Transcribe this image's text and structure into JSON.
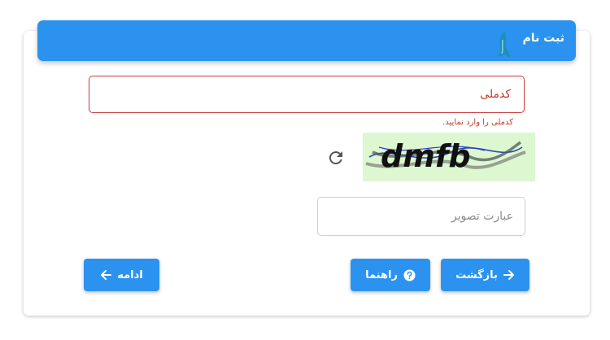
{
  "header": {
    "title": "ثبت نام",
    "logo_icon": "logo-icon",
    "color": "#2b93ef"
  },
  "form": {
    "national_code": {
      "value": "",
      "placeholder": "کدملی",
      "error": "کدملی را وارد نمایید."
    },
    "captcha": {
      "image_text": "dmfb",
      "refresh_icon": "refresh-icon",
      "input_value": "",
      "input_placeholder": "عبارت تصویر"
    }
  },
  "buttons": {
    "back": {
      "label": "بازگشت",
      "icon": "arrow-right-icon"
    },
    "help": {
      "label": "راهنما",
      "icon": "question-circle-icon"
    },
    "continue": {
      "label": "ادامه",
      "icon": "arrow-left-icon"
    }
  },
  "colors": {
    "primary": "#2b93ef",
    "error": "#c0392b"
  }
}
